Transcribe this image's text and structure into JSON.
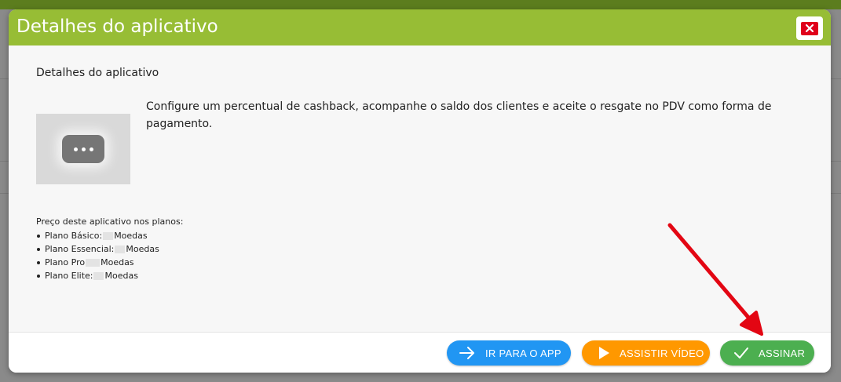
{
  "modal": {
    "title": "Detalhes do aplicativo",
    "close_icon": "close-icon",
    "section_title": "Detalhes do aplicativo",
    "description": "Configure um percentual de cashback, acompanhe o saldo dos clientes e aceite o resgate no PDV como forma de pagamento.",
    "thumbnail_icon": "chat-bubble-dots-icon",
    "prices_heading": "Preço deste aplicativo nos planos:",
    "plans": [
      {
        "name": "Plano Básico:",
        "unit": "Moedas"
      },
      {
        "name": "Plano Essencial:",
        "unit": "Moedas"
      },
      {
        "name": "Plano Pro",
        "unit": "Moedas"
      },
      {
        "name": "Plano Elite:",
        "unit": "Moedas"
      }
    ]
  },
  "footer": {
    "go_to_app_label": "IR PARA O APP",
    "watch_video_label": "ASSISTIR VÍDEO",
    "subscribe_label": "ASSINAR"
  },
  "colors": {
    "header": "#97bd35",
    "close": "#e0001b",
    "go_to_app": "#2196f3",
    "watch_video": "#ff9800",
    "subscribe": "#4caf50",
    "annotation_arrow": "#e30613"
  }
}
